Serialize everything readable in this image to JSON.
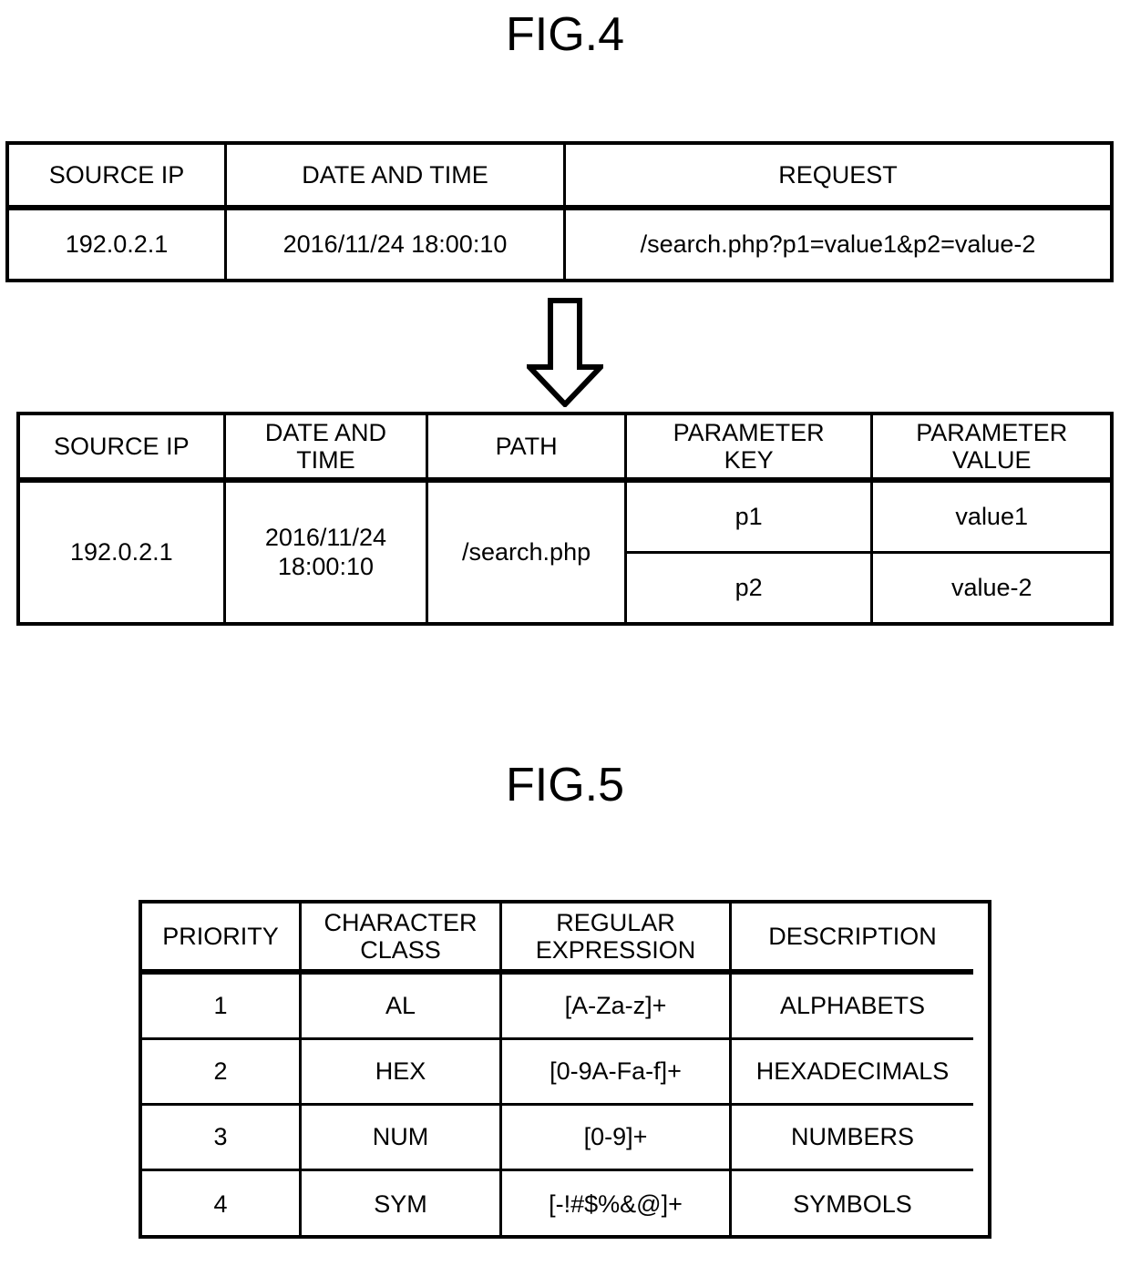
{
  "figures": {
    "fig4": {
      "title": "FIG.4",
      "arrow_icon": "down-block-arrow-icon",
      "table_before": {
        "headers": [
          "SOURCE IP",
          "DATE AND TIME",
          "REQUEST"
        ],
        "rows": [
          [
            "192.0.2.1",
            "2016/11/24 18:00:10",
            "/search.php?p1=value1&p2=value-2"
          ]
        ]
      },
      "table_after": {
        "headers": [
          "SOURCE IP",
          "DATE AND\nTIME",
          "PATH",
          "PARAMETER\nKEY",
          "PARAMETER\nVALUE"
        ],
        "row": {
          "source_ip": "192.0.2.1",
          "date_and_time": "2016/11/24\n18:00:10",
          "path": "/search.php",
          "parameters": [
            {
              "key": "p1",
              "value": "value1"
            },
            {
              "key": "p2",
              "value": "value-2"
            }
          ]
        }
      }
    },
    "fig5": {
      "title": "FIG.5",
      "table": {
        "headers": [
          "PRIORITY",
          "CHARACTER\nCLASS",
          "REGULAR\nEXPRESSION",
          "DESCRIPTION"
        ],
        "rows": [
          [
            "1",
            "AL",
            "[A-Za-z]+",
            "ALPHABETS"
          ],
          [
            "2",
            "HEX",
            "[0-9A-Fa-f]+",
            "HEXADECIMALS"
          ],
          [
            "3",
            "NUM",
            "[0-9]+",
            "NUMBERS"
          ],
          [
            "4",
            "SYM",
            "[-!#$%&@]+",
            "SYMBOLS"
          ]
        ]
      }
    }
  },
  "colors": {
    "ink": "#000000",
    "paper": "#ffffff"
  }
}
